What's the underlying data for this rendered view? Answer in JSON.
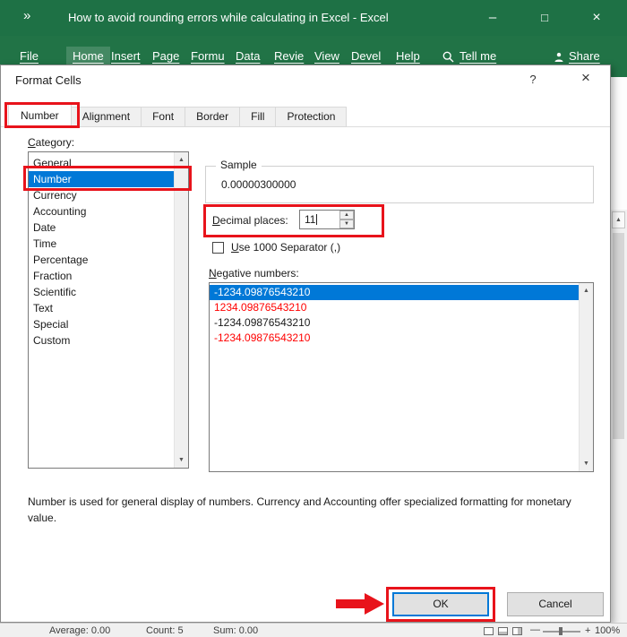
{
  "colors": {
    "excel_green": "#1e7145",
    "selection_blue": "#0078d7",
    "annotation_red": "#e8131b",
    "negative_red": "#ff0000"
  },
  "icons": {
    "qat_overflow": "»",
    "minimize": "–",
    "maximize": "□",
    "close": "×",
    "dialog_help": "?",
    "dialog_close": "×",
    "spin_up": "▲",
    "spin_down": "▼",
    "scroll_up": "▲",
    "scroll_down": "▼",
    "zoom_out": "—",
    "zoom_in": "+"
  },
  "titlebar": {
    "title": "How to avoid rounding errors while calculating in Excel  -  Excel"
  },
  "ribbon": {
    "tabs": [
      "File",
      "Home",
      "Insert",
      "Page",
      "Formu",
      "Data",
      "Revie",
      "View",
      "Devel",
      "Help"
    ],
    "active_tab": "Home",
    "tell_me": "Tell me",
    "share": "Share"
  },
  "dialog": {
    "title": "Format Cells",
    "tabs": [
      "Number",
      "Alignment",
      "Font",
      "Border",
      "Fill",
      "Protection"
    ],
    "active_tab": "Number",
    "category_label": "Category:",
    "categories": [
      "General",
      "Number",
      "Currency",
      "Accounting",
      "Date",
      "Time",
      "Percentage",
      "Fraction",
      "Scientific",
      "Text",
      "Special",
      "Custom"
    ],
    "selected_category": "Number",
    "sample_label": "Sample",
    "sample_value": "0.00000300000",
    "decimal_label": "Decimal places:",
    "decimal_value": "11",
    "separator_label": "Use 1000 Separator (,)",
    "separator_checked": false,
    "negative_label": "Negative numbers:",
    "negative_items": [
      {
        "text": "-1234.09876543210",
        "style": "selected-blue"
      },
      {
        "text": "1234.09876543210",
        "style": "red"
      },
      {
        "text": "-1234.09876543210",
        "style": "black"
      },
      {
        "text": "-1234.09876543210",
        "style": "red"
      }
    ],
    "description": "Number is used for general display of numbers.  Currency and Accounting offer specialized formatting for monetary value.",
    "ok_label": "OK",
    "cancel_label": "Cancel"
  },
  "statusbar": {
    "average": "Average: 0.00",
    "count": "Count: 5",
    "sum": "Sum: 0.00",
    "zoom_level": "100%"
  }
}
